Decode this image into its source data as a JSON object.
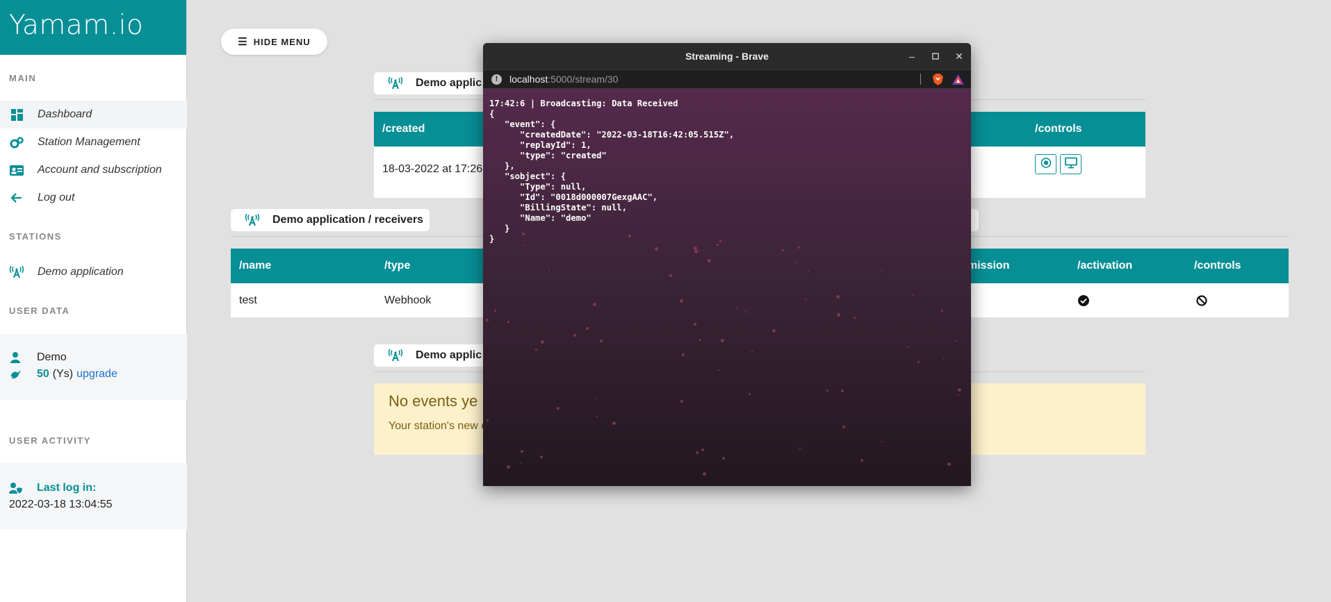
{
  "sidebar": {
    "brand": "Yamam.io",
    "main_label": "MAIN",
    "nav": [
      {
        "label": "Dashboard",
        "icon": "grid-icon"
      },
      {
        "label": "Station Management",
        "icon": "gears-icon"
      },
      {
        "label": "Account and subscription",
        "icon": "id-card-icon"
      },
      {
        "label": "Log out",
        "icon": "arrow-left-icon"
      }
    ],
    "stations_label": "STATIONS",
    "stations": [
      {
        "label": "Demo application",
        "icon": "antenna-icon"
      }
    ],
    "user_data_label": "USER DATA",
    "user": {
      "name": "Demo",
      "credits": "50",
      "unit": "(Ys)",
      "upgrade": "upgrade"
    },
    "user_activity_label": "USER ACTIVITY",
    "last_login_label": "Last log in:",
    "last_login_value": "2022-03-18 13:04:55"
  },
  "main": {
    "hide_menu": "HIDE MENU",
    "events_pill": "Demo applic",
    "events_table": {
      "col_created": "/created",
      "col_controls": "/controls",
      "row_created": "18-03-2022 at 17:26"
    },
    "receivers_pill": "Demo application / receivers",
    "receivers_table": {
      "headers": [
        "/name",
        "/type",
        "mission",
        "/activation",
        "/controls"
      ],
      "rows": [
        {
          "name": "test",
          "type": "Webhook"
        }
      ]
    },
    "third_pill": "Demo applic",
    "no_events": {
      "title": "No events ye",
      "desc": "Your station's new e"
    }
  },
  "browser": {
    "title": "Streaming - Brave",
    "url_host": "localhost",
    "url_path": ":5000/stream/30",
    "content": "17:42:6 | Broadcasting: Data Received\n{\n   \"event\": {\n      \"createdDate\": \"2022-03-18T16:42:05.515Z\",\n      \"replayId\": 1,\n      \"type\": \"created\"\n   },\n   \"sobject\": {\n      \"Type\": null,\n      \"Id\": \"0018d000007GexgAAC\",\n      \"BillingState\": null,\n      \"Name\": \"demo\"\n   }\n}"
  },
  "colors": {
    "accent": "#078f96",
    "warning_bg": "#fdf1cc",
    "link": "#1a73c8"
  }
}
